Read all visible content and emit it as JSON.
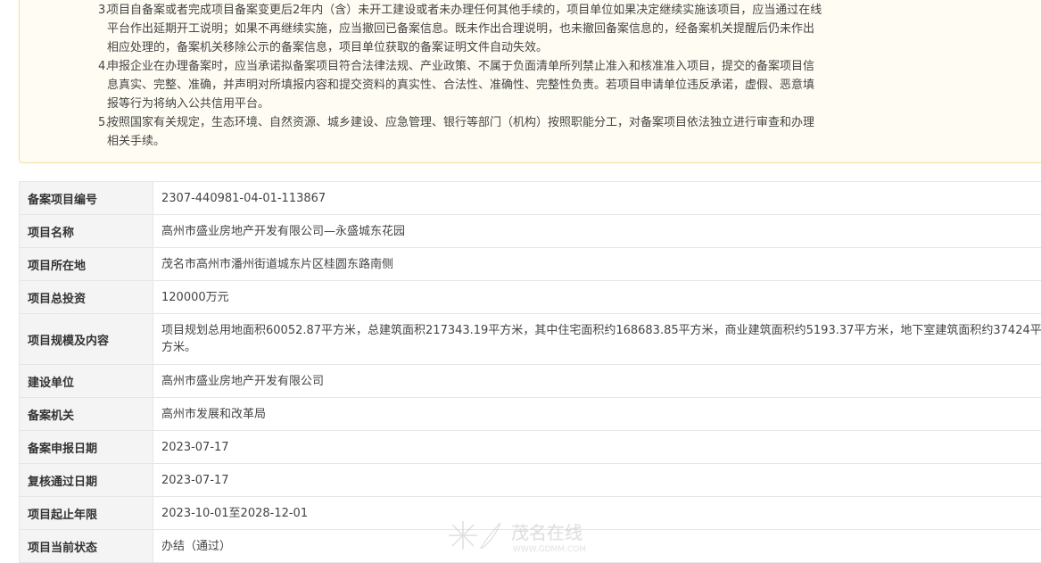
{
  "notice": {
    "items": [
      {
        "num": "3.",
        "lines": [
          "项目自备案或者完成项目备案变更后2年内（含）未开工建设或者未办理任何其他手续的，项目单位如果决定继续实施该项目，应当通过在线",
          "平台作出延期开工说明；如果不再继续实施，应当撤回已备案信息。既未作出合理说明，也未撤回备案信息的，经备案机关提醒后仍未作出",
          "相应处理的，备案机关移除公示的备案信息，项目单位获取的备案证明文件自动失效。"
        ]
      },
      {
        "num": "4.",
        "lines": [
          "申报企业在办理备案时，应当承诺拟备案项目符合法律法规、产业政策、不属于负面清单所列禁止准入和核准准入项目，提交的备案项目信",
          "息真实、完整、准确，并声明对所填报内容和提交资料的真实性、合法性、准确性、完整性负责。若项目申请单位违反承诺，虚假、恶意填",
          "报等行为将纳入公共信用平台。"
        ]
      },
      {
        "num": "5.",
        "lines": [
          "按照国家有关规定，生态环境、自然资源、城乡建设、应急管理、银行等部门（机构）按照职能分工，对备案项目依法独立进行审查和办理",
          "相关手续。"
        ]
      }
    ]
  },
  "table": {
    "rows": [
      {
        "label": "备案项目编号",
        "value": "2307-440981-04-01-113867"
      },
      {
        "label": "项目名称",
        "value": "高州市盛业房地产开发有限公司—永盛城东花园"
      },
      {
        "label": "项目所在地",
        "value": "茂名市高州市潘州街道城东片区桂圆东路南侧"
      },
      {
        "label": "项目总投资",
        "value": "120000万元"
      },
      {
        "label": "项目规模及内容",
        "value": "项目规划总用地面积60052.87平方米，总建筑面积217343.19平方米，其中住宅面积约168683.85平方米，商业建筑面积约5193.37平方米，地下室建筑面积约37424平方米。"
      },
      {
        "label": "建设单位",
        "value": "高州市盛业房地产开发有限公司"
      },
      {
        "label": "备案机关",
        "value": "高州市发展和改革局"
      },
      {
        "label": "备案申报日期",
        "value": "2023-07-17"
      },
      {
        "label": "复核通过日期",
        "value": "2023-07-17"
      },
      {
        "label": "项目起止年限",
        "value": "2023-10-01至2028-12-01"
      },
      {
        "label": "项目当前状态",
        "value": "办结（通过）"
      }
    ]
  },
  "watermark": {
    "logo_text": "茂名在线",
    "url": "WWW.GDMM.COM"
  }
}
